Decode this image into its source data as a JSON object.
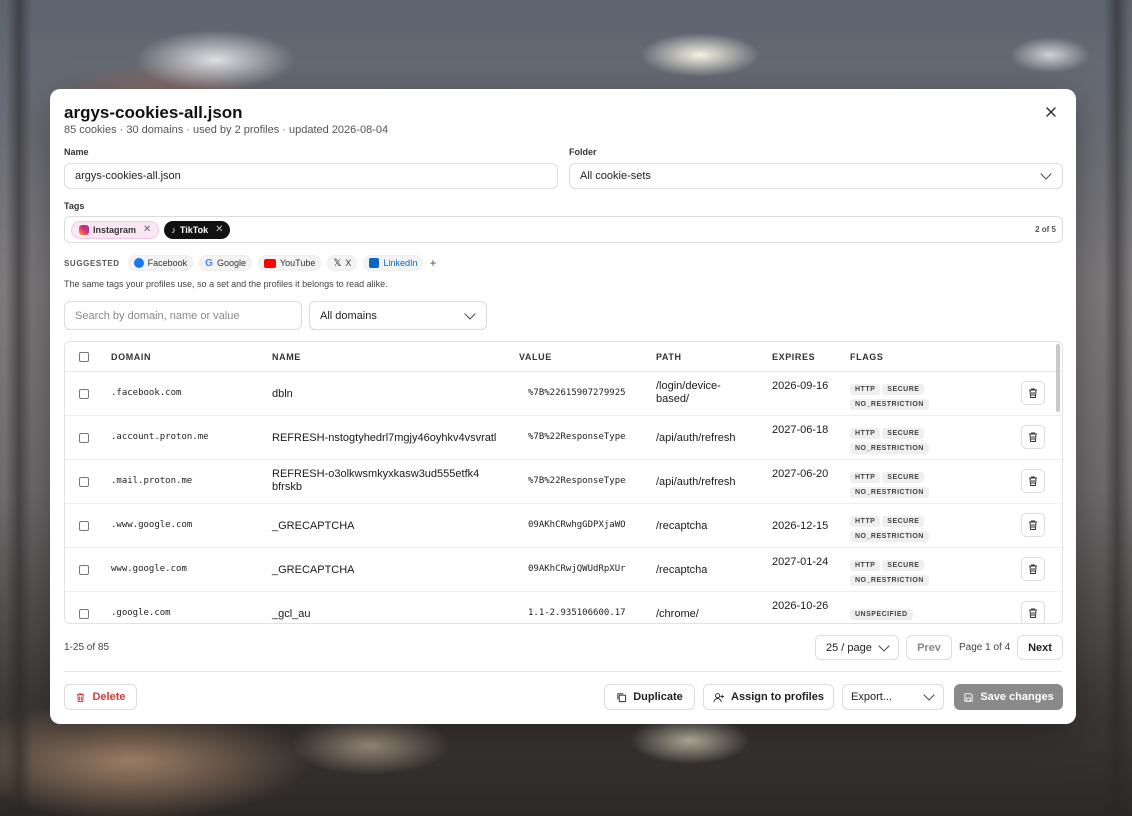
{
  "dialog": {
    "title": "argys-cookies-all.json",
    "subtitle": "85 cookies · 30 domains · used by 2 profiles · updated 2026-08-04",
    "close_icon": "close-icon"
  },
  "form": {
    "name_label": "Name",
    "name_value": "argys-cookies-all.json",
    "folder_label": "Folder",
    "folder_value": "All cookie-sets",
    "tags_label": "Tags",
    "tags": [
      {
        "label": "Instagram",
        "icon": "instagram-icon"
      },
      {
        "label": "TikTok",
        "icon": "tiktok-icon"
      }
    ],
    "tags_count": "2 of 5",
    "suggested_label": "SUGGESTED",
    "suggested": [
      {
        "label": "Facebook",
        "icon": "facebook-icon",
        "color": "#1877f2"
      },
      {
        "label": "Google",
        "icon": "google-icon",
        "color": "#4285f4"
      },
      {
        "label": "YouTube",
        "icon": "youtube-icon",
        "color": "#ff0000"
      },
      {
        "label": "X",
        "icon": "x-icon",
        "color": "#111111"
      },
      {
        "label": "LinkedIn",
        "icon": "linkedin-icon",
        "color": "#0a66c2"
      }
    ],
    "add_tag": "+",
    "tags_hint": "The same tags your profiles use, so a set and the profiles it belongs to read alike."
  },
  "filters": {
    "search_placeholder": "Search by domain, name or value",
    "domain_filter": "All domains"
  },
  "table": {
    "headers": [
      "DOMAIN",
      "NAME",
      "VALUE",
      "PATH",
      "EXPIRES",
      "FLAGS"
    ],
    "rows": [
      {
        "domain": ".facebook.com",
        "name": "dbln",
        "value": "%7B%22615907279925",
        "path": "/login/device-based/",
        "expires": "2026-09-16",
        "flags": [
          "HTTP",
          "SECURE",
          "NO_RESTRICTION"
        ]
      },
      {
        "domain": ".account.proton.me",
        "name": "REFRESH-nstogtyhedrl7mgjy46oyhkv4vsvratl",
        "value": "%7B%22ResponseType",
        "path": "/api/auth/refresh",
        "expires": "2027-06-18",
        "flags": [
          "HTTP",
          "SECURE",
          "NO_RESTRICTION"
        ]
      },
      {
        "domain": ".mail.proton.me",
        "name": "REFRESH-o3olkwsmkyxkasw3ud555etfk4bfrskb",
        "value": "%7B%22ResponseType",
        "path": "/api/auth/refresh",
        "expires": "2027-06-20",
        "flags": [
          "HTTP",
          "SECURE",
          "NO_RESTRICTION"
        ]
      },
      {
        "domain": ".www.google.com",
        "name": "_GRECAPTCHA",
        "value": "09AKhCRwhgGDPXjaWO",
        "path": "/recaptcha",
        "expires": "2026-12-15",
        "flags": [
          "HTTP",
          "SECURE",
          "NO_RESTRICTION"
        ]
      },
      {
        "domain": "www.google.com",
        "name": "_GRECAPTCHA",
        "value": "09AKhCRwjQWUdRpXUr",
        "path": "/recaptcha",
        "expires": "2027-01-24",
        "flags": [
          "HTTP",
          "SECURE",
          "NO_RESTRICTION"
        ]
      },
      {
        "domain": ".google.com",
        "name": "_gcl_au",
        "value": "1.1-2.935106600.17",
        "path": "/chrome/",
        "expires": "2026-10-26",
        "flags": [
          "UNSPECIFIED"
        ]
      }
    ]
  },
  "pagination": {
    "range": "1-25 of 85",
    "per_page": "25 / page",
    "prev": "Prev",
    "page_info": "Page 1 of 4",
    "next": "Next"
  },
  "footer": {
    "delete": "Delete",
    "duplicate": "Duplicate",
    "assign": "Assign to profiles",
    "export": "Export...",
    "save": "Save changes"
  },
  "colors": {
    "danger": "#d23b3b",
    "save_bg": "#8a8a8a"
  }
}
